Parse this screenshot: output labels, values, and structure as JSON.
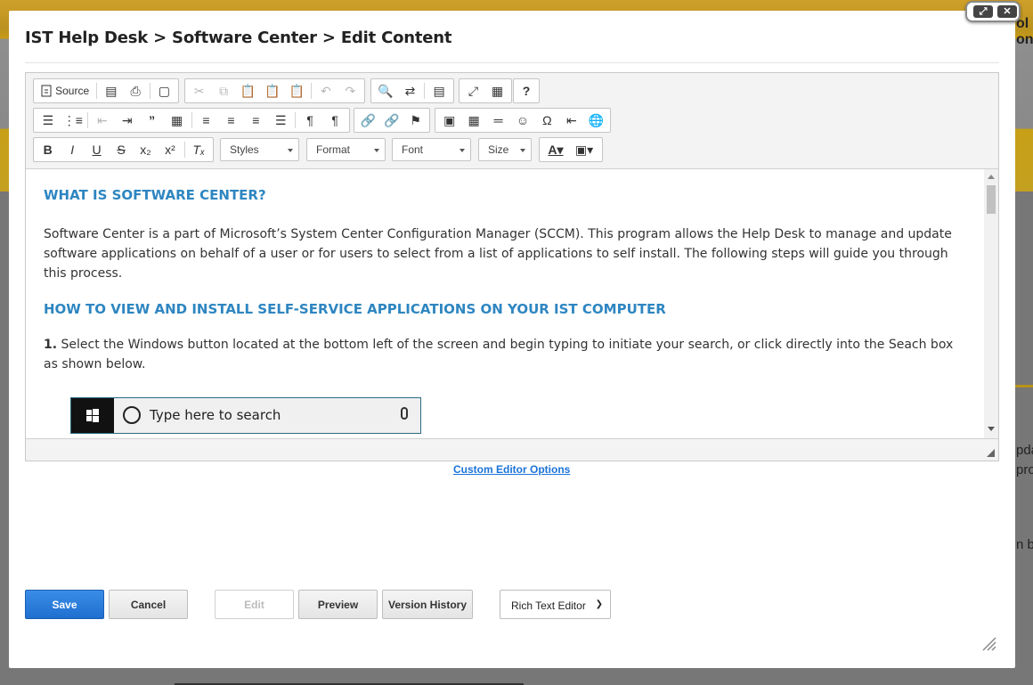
{
  "background": {
    "snippet_lines": [
      "ol",
      "on",
      "pda",
      "pro",
      "n bo"
    ]
  },
  "modal": {
    "title": "IST Help Desk > Software Center > Edit Content",
    "controls": {
      "maximize_icon": "expand-icon",
      "close_icon": "close-icon"
    }
  },
  "toolbar": {
    "source_label": "Source",
    "combos": {
      "styles": "Styles",
      "format": "Format",
      "font": "Font",
      "size": "Size"
    }
  },
  "content": {
    "heading1": "WHAT IS SOFTWARE CENTER?",
    "paragraph1": "Software Center is a part of Microsoft’s System Center Configuration Manager (SCCM).  This program allows the Help Desk to manage and update software applications on behalf of a user or for users to select from a list of applications to self install. The following steps will guide you through this process.",
    "heading2": "HOW TO VIEW AND INSTALL SELF-SERVICE APPLICATIONS ON YOUR IST COMPUTER",
    "step1_number": "1.",
    "step1_text": " Select the Windows button located at the bottom left of the screen and begin typing to initiate your search, or click directly into the Seach box as shown below.",
    "search_placeholder": "Type here to search"
  },
  "custom_editor_link": "Custom Editor Options",
  "buttons": {
    "save": "Save",
    "cancel": "Cancel",
    "edit": "Edit",
    "preview": "Preview",
    "version_history": "Version History"
  },
  "editor_mode": {
    "selected": "Rich Text Editor"
  },
  "colors": {
    "accent": "#2e86c1",
    "primary_button": "#1f6fd0",
    "link": "#1a73d9"
  }
}
